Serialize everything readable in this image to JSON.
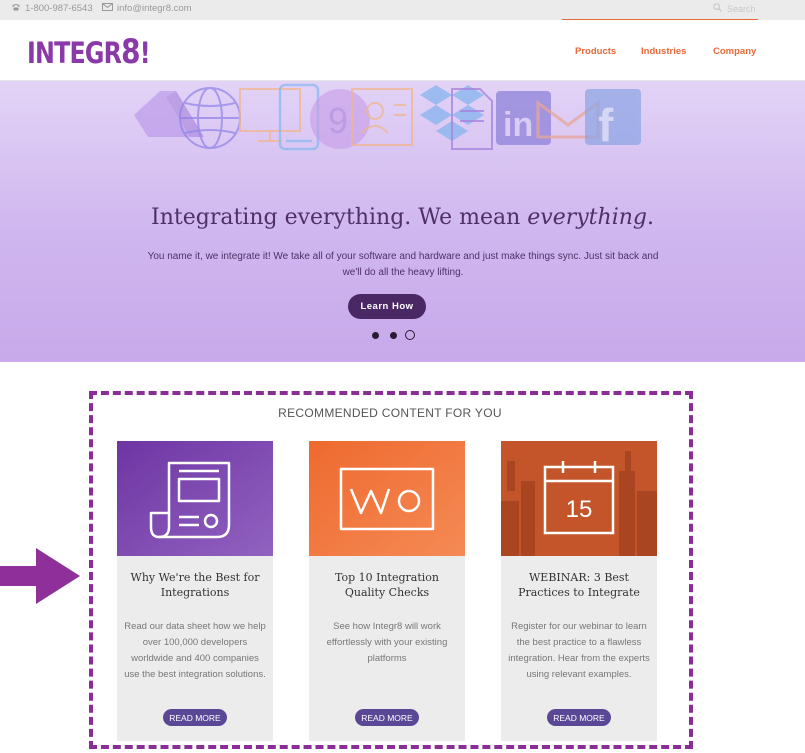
{
  "topbar": {
    "phone": "1-800-987-6543",
    "email": "info@integr8.com",
    "search_placeholder": "Search"
  },
  "header": {
    "logo_text": "INTEGR",
    "logo_eight": "8",
    "logo_bang": "!",
    "nav": [
      {
        "label": "Products"
      },
      {
        "label": "Industries"
      },
      {
        "label": "Company"
      }
    ]
  },
  "hero": {
    "title_plain": "Integrating everything. We mean ",
    "title_emph": "everything",
    "title_end": ".",
    "subtitle_line1": "You name it, we integrate it! We take all of your software and hardware and just make things sync. Just sit back and",
    "subtitle_line2": "we'll do all the heavy lifting.",
    "button_label": "Learn How",
    "icons": [
      "drive-icon",
      "globe-icon",
      "monitor-icon",
      "tablet-icon",
      "chrome-icon",
      "contacts-icon",
      "dropbox-icon",
      "document-icon",
      "linkedin-icon",
      "gmail-icon",
      "facebook-icon"
    ],
    "carousel_dots": 3,
    "active_dot": 3
  },
  "recommended": {
    "heading": "RECOMMENDED CONTENT FOR YOU",
    "cards": [
      {
        "title": "Why We're the Best for Integrations",
        "description": "Read our data sheet how we help over 100,000 developers worldwide and 400 companies use the best integration solutions.",
        "button": "READ MORE",
        "icon": "datasheet-icon",
        "color": "#7a43a9"
      },
      {
        "title": "Top 10 Integration Quality Checks",
        "description": "See how Integr8 will work effortlessly with your existing platforms",
        "button": "READ MORE",
        "icon": "checks-icon",
        "color": "#ef6f36"
      },
      {
        "title": "WEBINAR: 3 Best Practices to Integrate",
        "description": "Register for our webinar to learn the best practice to a flawless integration. Hear from the experts using relevant examples.",
        "button": "READ MORE",
        "icon": "calendar-icon",
        "calendar_day": "15",
        "color": "#c8572e"
      }
    ]
  },
  "colors": {
    "accent": "#e8693a",
    "brand_purple": "#8a3aa8",
    "highlight_border": "#8a2d96",
    "button_purple": "#5a4896"
  }
}
